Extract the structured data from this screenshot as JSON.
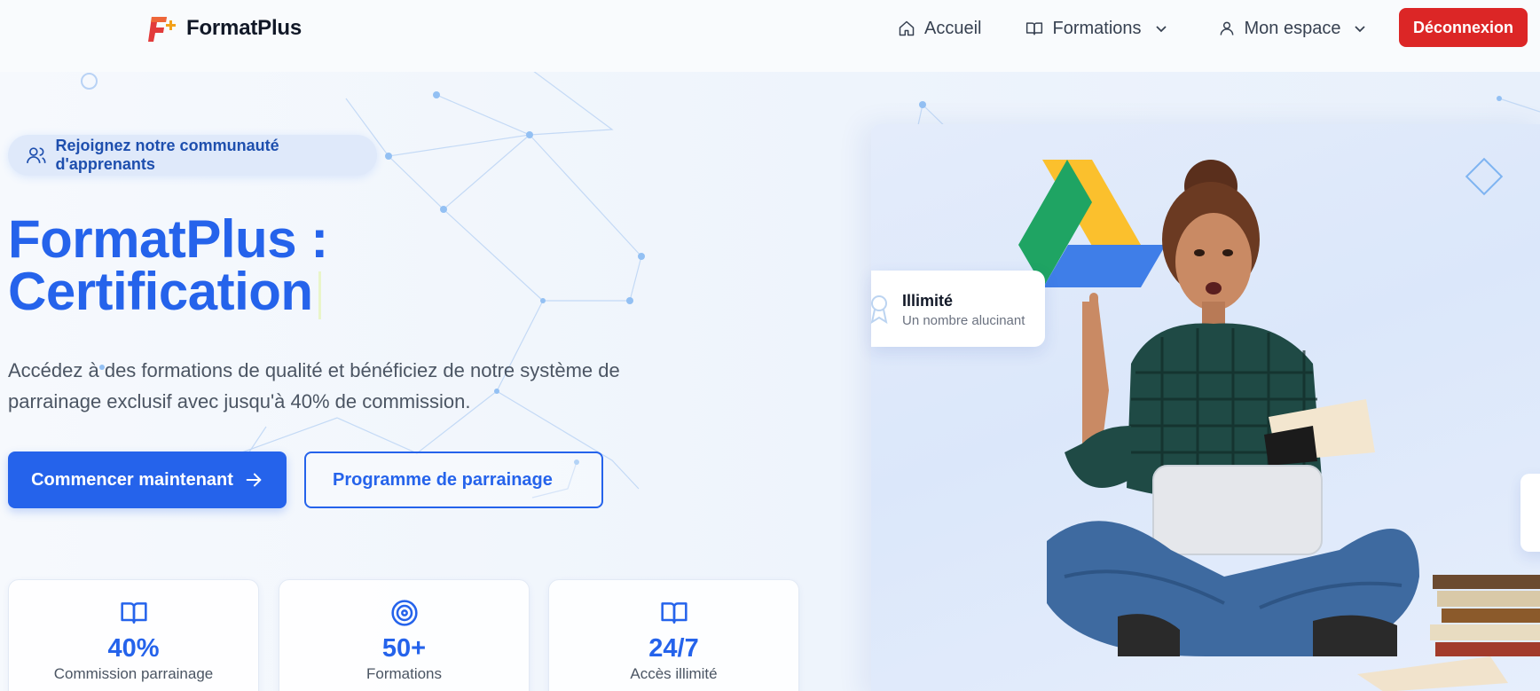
{
  "brand": {
    "name": "FormatPlus"
  },
  "nav": {
    "accueil": "Accueil",
    "formations": "Formations",
    "mon_espace": "Mon espace",
    "logout": "Déconnexion"
  },
  "hero": {
    "community": "Rejoignez notre communauté d'apprenants",
    "title_line1": "FormatPlus :",
    "title_line2": "Certification",
    "description": "Accédez à des formations de qualité et bénéficiez de notre système de parrainage exclusif avec jusqu'à 40% de commission.",
    "cta_primary": "Commencer maintenant",
    "cta_secondary": "Programme de parrainage"
  },
  "stats": [
    {
      "icon": "book-open-icon",
      "value": "40%",
      "label": "Commission parrainage"
    },
    {
      "icon": "target-icon",
      "value": "50+",
      "label": "Formations"
    },
    {
      "icon": "book-open-icon",
      "value": "24/7",
      "label": "Accès illimité"
    }
  ],
  "floating_card": {
    "title": "Illimité",
    "subtitle": "Un nombre alucinant"
  },
  "colors": {
    "primary": "#2563eb",
    "danger": "#dc2626",
    "text": "#4b5563"
  }
}
